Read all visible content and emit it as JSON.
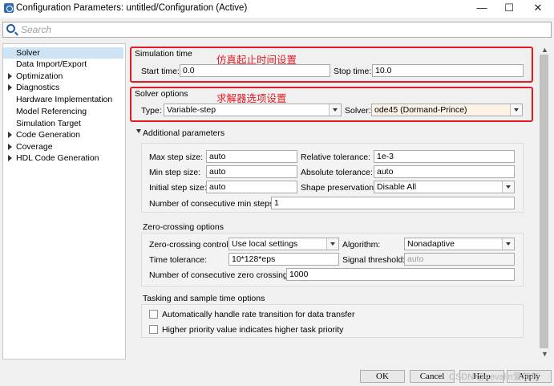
{
  "window": {
    "title": "Configuration Parameters: untitled/Configuration (Active)",
    "minimize_glyph": "—",
    "maximize_glyph": "☐",
    "close_glyph": "✕"
  },
  "search": {
    "placeholder": "Search"
  },
  "tree": {
    "items": [
      {
        "label": "Solver",
        "selected": true,
        "expandable": false
      },
      {
        "label": "Data Import/Export",
        "expandable": false
      },
      {
        "label": "Optimization",
        "expandable": true
      },
      {
        "label": "Diagnostics",
        "expandable": true
      },
      {
        "label": "Hardware Implementation",
        "expandable": false
      },
      {
        "label": "Model Referencing",
        "expandable": false
      },
      {
        "label": "Simulation Target",
        "expandable": false
      },
      {
        "label": "Code Generation",
        "expandable": true
      },
      {
        "label": "Coverage",
        "expandable": true
      },
      {
        "label": "HDL Code Generation",
        "expandable": true
      }
    ]
  },
  "simulation_time": {
    "title": "Simulation time",
    "annotation": "仿真起止时间设置",
    "start_label": "Start time:",
    "start_value": "0.0",
    "stop_label": "Stop time:",
    "stop_value": "10.0"
  },
  "solver_options": {
    "title": "Solver options",
    "annotation": "求解器选项设置",
    "type_label": "Type:",
    "type_value": "Variable-step",
    "solver_label": "Solver:",
    "solver_value": "ode45 (Dormand-Prince)"
  },
  "additional": {
    "title": "Additional parameters",
    "max_step_label": "Max step size:",
    "max_step_value": "auto",
    "rel_tol_label": "Relative tolerance:",
    "rel_tol_value": "1e-3",
    "min_step_label": "Min step size:",
    "min_step_value": "auto",
    "abs_tol_label": "Absolute tolerance:",
    "abs_tol_value": "auto",
    "init_step_label": "Initial step size:",
    "init_step_value": "auto",
    "shape_label": "Shape preservation:",
    "shape_value": "Disable All",
    "consec_min_label": "Number of consecutive min steps:",
    "consec_min_value": "1"
  },
  "zero_crossing": {
    "title": "Zero-crossing options",
    "control_label": "Zero-crossing control:",
    "control_value": "Use local settings",
    "algorithm_label": "Algorithm:",
    "algorithm_value": "Nonadaptive",
    "time_tol_label": "Time tolerance:",
    "time_tol_value": "10*128*eps",
    "signal_thr_label": "Signal threshold:",
    "signal_thr_value": "auto",
    "consec_zc_label": "Number of consecutive zero crossings:",
    "consec_zc_value": "1000"
  },
  "tasking": {
    "title": "Tasking and sample time options",
    "auto_rate_label": "Automatically handle rate transition for data transfer",
    "auto_rate_checked": false,
    "priority_label": "Higher priority value indicates higher task priority",
    "priority_checked": false
  },
  "buttons": {
    "ok": "OK",
    "cancel": "Cancel",
    "help": "Help",
    "apply": "Apply"
  },
  "watermark": "CSDN @zevalin爱灰灰",
  "colors": {
    "annotation_border": "#e31b23",
    "selected_bg": "#cde4f7",
    "solver_dropdown_bg": "#fdf2e6"
  }
}
